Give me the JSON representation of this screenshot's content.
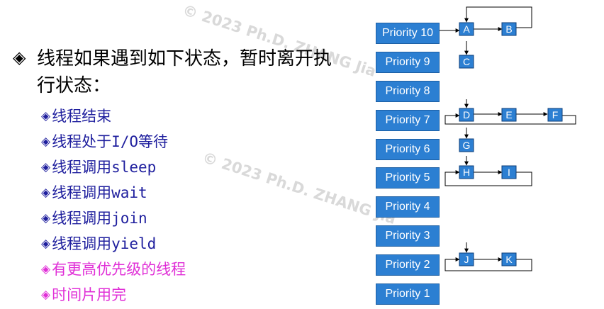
{
  "watermark": {
    "text_top": "© 2023 Ph.D. ZHANG Jia",
    "text_mid": "© 2023 Ph.D. ZHANG Jia"
  },
  "heading": {
    "bullet": "◈",
    "text": "线程如果遇到如下状态，暂时离开执行状态："
  },
  "items": [
    {
      "bullet": "◈",
      "text": "线程结束",
      "color": "#1f1f9e"
    },
    {
      "bullet": "◈",
      "text": "线程处于I/O等待",
      "color": "#1f1f9e"
    },
    {
      "bullet": "◈",
      "text": "线程调用sleep",
      "color": "#1f1f9e"
    },
    {
      "bullet": "◈",
      "text": "线程调用wait",
      "color": "#1f1f9e"
    },
    {
      "bullet": "◈",
      "text": "线程调用join",
      "color": "#1f1f9e"
    },
    {
      "bullet": "◈",
      "text": "线程调用yield",
      "color": "#1f1f9e"
    },
    {
      "bullet": "◈",
      "text": "有更高优先级的线程",
      "color": "#e02fd7"
    },
    {
      "bullet": "◈",
      "text": "时间片用完",
      "color": "#e02fd7"
    }
  ],
  "priorities": [
    {
      "label": "Priority 10",
      "threads": [
        "A",
        "B"
      ]
    },
    {
      "label": "Priority 9",
      "threads": [
        "C"
      ]
    },
    {
      "label": "Priority 8",
      "threads": []
    },
    {
      "label": "Priority 7",
      "threads": [
        "D",
        "E",
        "F"
      ]
    },
    {
      "label": "Priority 6",
      "threads": [
        "G"
      ]
    },
    {
      "label": "Priority 5",
      "threads": [
        "H",
        "I"
      ]
    },
    {
      "label": "Priority 4",
      "threads": []
    },
    {
      "label": "Priority 3",
      "threads": []
    },
    {
      "label": "Priority 2",
      "threads": [
        "J",
        "K"
      ]
    },
    {
      "label": "Priority 1",
      "threads": []
    }
  ],
  "colors": {
    "priority_box": "#2c7fd2",
    "node_box": "#2c7fd2",
    "text_blue": "#1f1f9e",
    "text_magenta": "#e02fd7"
  }
}
